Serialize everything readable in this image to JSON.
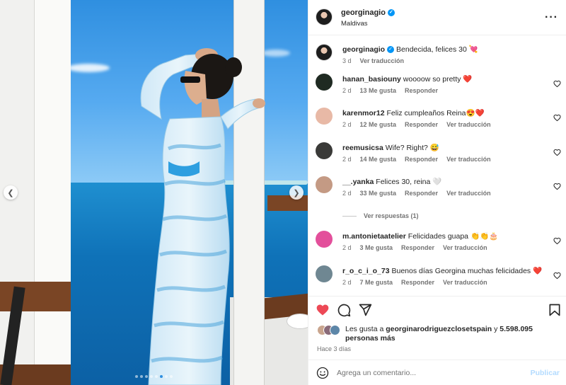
{
  "post": {
    "username": "georginagio",
    "location": "Maldivas",
    "caption": {
      "user": "georginagio",
      "text": "Bendecida, felices 30 💘",
      "time": "3 d",
      "translate": "Ver traducción"
    }
  },
  "carousel": {
    "total_slides": 8,
    "active_slide": 5
  },
  "comments": [
    {
      "user": "hanan_basiouny",
      "text": "woooow so pretty ❤️",
      "time": "2 d",
      "likes": "13 Me gusta",
      "reply": "Responder",
      "translate": ""
    },
    {
      "user": "karenmor12",
      "text": "Feliz cumpleaños Reina😍❤️",
      "time": "2 d",
      "likes": "12 Me gusta",
      "reply": "Responder",
      "translate": "Ver traducción"
    },
    {
      "user": "reemusicsa",
      "text": "Wife? Right? 😅",
      "time": "2 d",
      "likes": "14 Me gusta",
      "reply": "Responder",
      "translate": "Ver traducción"
    },
    {
      "user": "__.yanka",
      "text": "Felices 30, reina 🤍",
      "time": "2 d",
      "likes": "33 Me gusta",
      "reply": "Responder",
      "translate": "Ver traducción"
    },
    {
      "user": "m.antonietaatelier",
      "text": "Felicidades guapa 👏👏🎂",
      "time": "2 d",
      "likes": "3 Me gusta",
      "reply": "Responder",
      "translate": "Ver traducción"
    },
    {
      "user": "r_o_c_i_o_73",
      "text": "Buenos días Georgina muchas felicidades ❤️",
      "time": "2 d",
      "likes": "7 Me gusta",
      "reply": "Responder",
      "translate": "Ver traducción"
    }
  ],
  "replies_link": "Ver respuestas (1)",
  "likes": {
    "prefix": "Les gusta a",
    "user": "georginarodriguezclosetspain",
    "connector": "y",
    "count": "5.598.095",
    "suffix": "personas más"
  },
  "posted_ago": "Hace 3 días",
  "composer": {
    "placeholder": "Agrega un comentario...",
    "publish": "Publicar"
  },
  "colors": {
    "like_red": "#ed4956",
    "verified_blue": "#0095f6",
    "publish_disabled": "#b3dbff",
    "meta_gray": "#737373"
  },
  "icons": [
    "chevron-left-icon",
    "chevron-right-icon",
    "more-icon",
    "heart-icon",
    "comment-icon",
    "share-icon",
    "bookmark-icon",
    "emoji-icon",
    "verified-icon"
  ]
}
